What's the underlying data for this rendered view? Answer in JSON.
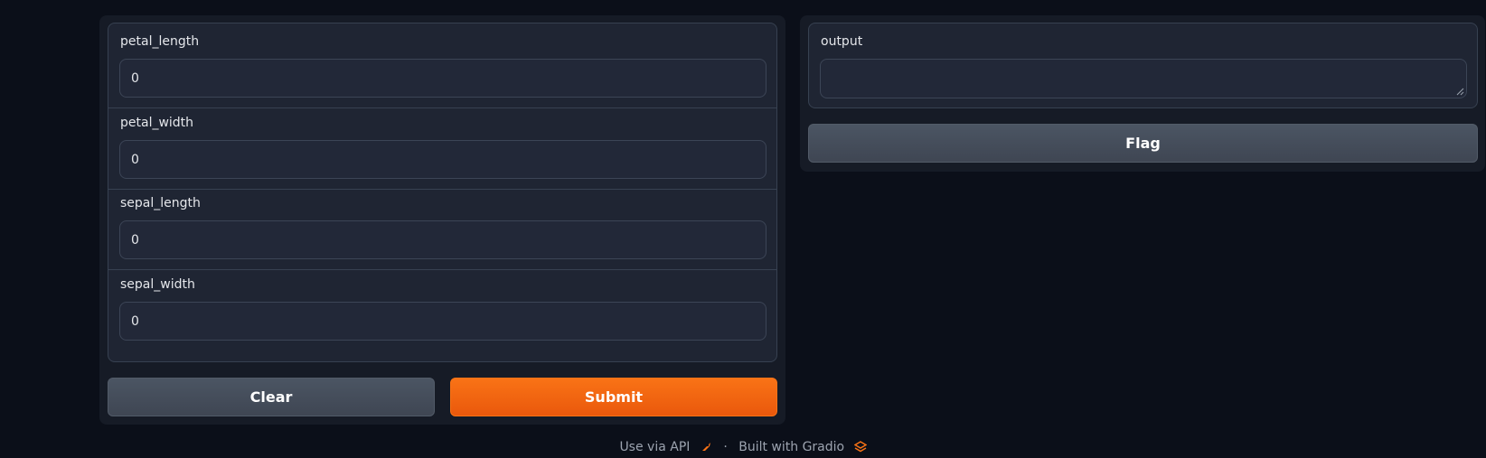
{
  "inputs": [
    {
      "label": "petal_length",
      "value": "0"
    },
    {
      "label": "petal_width",
      "value": "0"
    },
    {
      "label": "sepal_length",
      "value": "0"
    },
    {
      "label": "sepal_width",
      "value": "0"
    }
  ],
  "buttons": {
    "clear": "Clear",
    "submit": "Submit",
    "flag": "Flag"
  },
  "output": {
    "label": "output",
    "value": ""
  },
  "footer": {
    "api_link": "Use via API",
    "separator": "·",
    "built_with": "Built with Gradio",
    "rocket_icon": "rocket-icon",
    "gradio_icon": "gradio-logo-icon"
  },
  "colors": {
    "accent": "#f97316",
    "background": "#0b0f19",
    "panel": "#1f2533"
  }
}
